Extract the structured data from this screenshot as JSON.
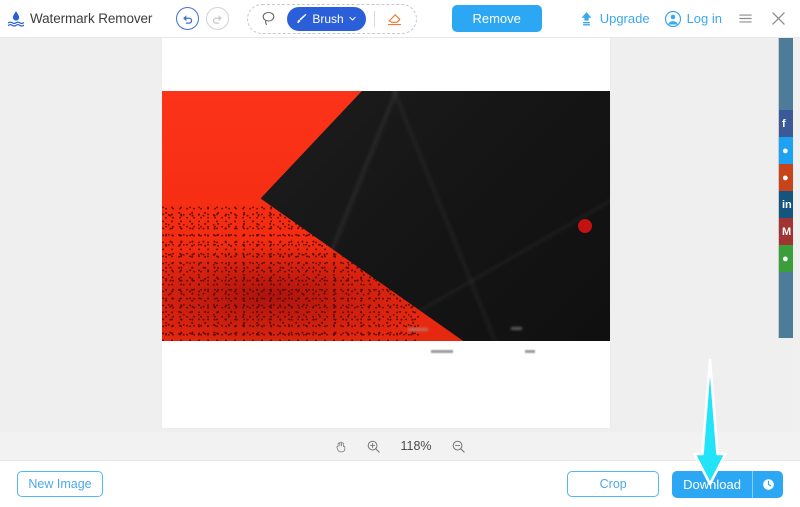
{
  "app": {
    "title": "Watermark Remover",
    "logo_icon": "water-drop-waves-logo"
  },
  "header": {
    "undo": {
      "label": "Undo",
      "icon": "undo-arrow-icon",
      "state": "active"
    },
    "redo": {
      "label": "Redo",
      "icon": "redo-arrow-icon",
      "state": "disabled"
    },
    "tools": {
      "lasso": {
        "label": "Lasso",
        "icon": "lasso-icon"
      },
      "brush": {
        "label": "Brush",
        "icon": "brush-icon",
        "chevron": "chevron-down-icon",
        "selected": true
      },
      "eraser": {
        "label": "Eraser",
        "icon": "eraser-icon"
      }
    },
    "remove_button": "Remove",
    "upgrade": {
      "label": "Upgrade",
      "icon": "upload-arrow-icon"
    },
    "login": {
      "label": "Log in",
      "icon": "user-circle-icon"
    },
    "menu_icon": "hamburger-menu-icon",
    "close_icon": "close-x-icon"
  },
  "canvas": {
    "zoom_level": "118%",
    "hand_tool_icon": "hand-grab-icon",
    "zoom_in_icon": "zoom-in-icon",
    "zoom_out_icon": "zoom-out-icon",
    "artwork_description": "red and black abstract image",
    "brush_mark": "red-dot-brush-mark"
  },
  "footer": {
    "new_image": "New Image",
    "crop": "Crop",
    "download": "Download",
    "download_history_icon": "clock-icon"
  },
  "annotation": {
    "arrow_icon": "down-arrow-annotation",
    "arrow_color": "#22E3F7",
    "points_at": "Download"
  },
  "social_rail": {
    "items": [
      {
        "name": "facebook",
        "glyph": "f",
        "color": "#3b5998"
      },
      {
        "name": "twitter",
        "glyph": "ᵗ",
        "color": "#1da1f2"
      },
      {
        "name": "reddit",
        "glyph": "●",
        "color": "#c8431a"
      },
      {
        "name": "linkedin",
        "glyph": "in",
        "color": "#14557f"
      },
      {
        "name": "mail",
        "glyph": "M",
        "color": "#a33232"
      },
      {
        "name": "whatsapp",
        "glyph": "●",
        "color": "#3a9e3a"
      }
    ]
  },
  "colors": {
    "accent_blue": "#2ba7f3",
    "brush_blue": "#2a5fd9",
    "link_blue": "#3aa8ee",
    "arrow_cyan": "#22E3F7",
    "canvas_bg": "#efefef",
    "art_red": "#f42d12",
    "art_black": "#151515"
  }
}
